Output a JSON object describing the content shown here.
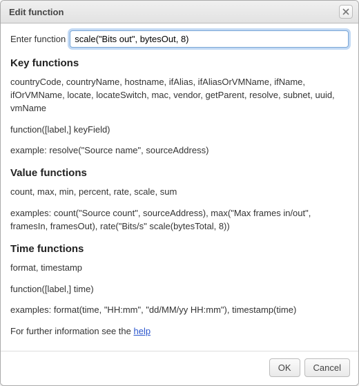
{
  "dialog": {
    "title": "Edit function",
    "close_icon": "close"
  },
  "form": {
    "label": "Enter function",
    "value": "scale(\"Bits out\", bytesOut, 8)"
  },
  "sections": {
    "key": {
      "heading": "Key functions",
      "list": "countryCode, countryName, hostname, ifAlias, ifAliasOrVMName, ifName, ifOrVMName, locate, locateSwitch, mac, vendor, getParent, resolve, subnet, uuid, vmName",
      "signature": "function([label,] keyField)",
      "example": "example: resolve(\"Source name\", sourceAddress)"
    },
    "value": {
      "heading": "Value functions",
      "list": "count, max, min, percent, rate, scale, sum",
      "examples": "examples: count(\"Source count\", sourceAddress), max(\"Max frames in/out\", framesIn, framesOut), rate(\"Bits/s\" scale(bytesTotal, 8))"
    },
    "time": {
      "heading": "Time functions",
      "list": "format, timestamp",
      "signature": "function([label,] time)",
      "examples": "examples: format(time, \"HH:mm\", \"dd/MM/yy HH:mm\"), timestamp(time)"
    }
  },
  "footer_text": {
    "prefix": "For further information see the ",
    "link": "help"
  },
  "buttons": {
    "ok": "OK",
    "cancel": "Cancel"
  }
}
